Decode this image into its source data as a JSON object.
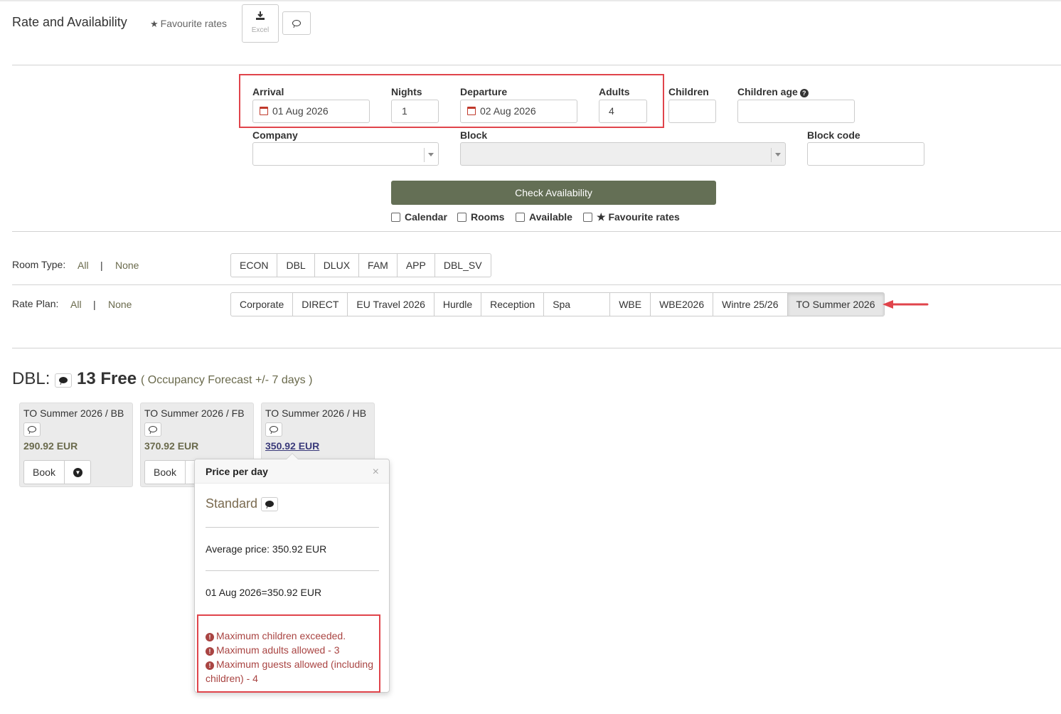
{
  "header": {
    "title": "Rate and Availability",
    "favourite_rates": "Favourite rates",
    "excel_label": "Excel"
  },
  "form": {
    "arrival_label": "Arrival",
    "arrival_value": "01 Aug 2026",
    "nights_label": "Nights",
    "nights_value": "1",
    "departure_label": "Departure",
    "departure_value": "02 Aug 2026",
    "adults_label": "Adults",
    "adults_value": "4",
    "children_label": "Children",
    "children_value": "",
    "children_age_label": "Children age",
    "children_age_value": "",
    "company_label": "Company",
    "block_label": "Block",
    "block_code_label": "Block code",
    "check_button": "Check Availability",
    "checkboxes": {
      "calendar": "Calendar",
      "rooms": "Rooms",
      "available": "Available",
      "favourite": "Favourite rates"
    }
  },
  "filters": {
    "room_type_label": "Room Type:",
    "rate_plan_label": "Rate Plan:",
    "all": "All",
    "none": "None",
    "pipe": "|",
    "room_types": [
      "ECON",
      "DBL",
      "DLUX",
      "FAM",
      "APP",
      "DBL_SV"
    ],
    "rate_plans": [
      "Corporate",
      "DIRECT",
      "EU Travel 2026",
      "Hurdle",
      "Reception",
      "Spa",
      "WBE",
      "WBE2026",
      "Wintre 25/26",
      "TO Summer 2026"
    ],
    "active_rate_plan": "TO Summer 2026"
  },
  "availability": {
    "room": "DBL:",
    "free": "13 Free",
    "forecast": "( Occupancy Forecast +/- 7 days )",
    "cards": [
      {
        "title": "TO Summer 2026 / BB",
        "price": "290.92 EUR",
        "book": "Book"
      },
      {
        "title": "TO Summer 2026 / FB",
        "price": "370.92 EUR",
        "book": "Book"
      },
      {
        "title": "TO Summer 2026 / HB",
        "price": "350.92 EUR"
      }
    ]
  },
  "popover": {
    "title": "Price per day",
    "close": "×",
    "rate_name": "Standard",
    "average": "Average price: 350.92 EUR",
    "daily": "01 Aug 2026=350.92 EUR",
    "errors": [
      "Maximum children exceeded.",
      "Maximum adults allowed - 3",
      "Maximum guests allowed (including",
      "children) - 4"
    ]
  },
  "colors": {
    "accent": "#646f55",
    "link": "#6a6a4c",
    "error": "#a94442",
    "highlight": "#e0444b"
  }
}
